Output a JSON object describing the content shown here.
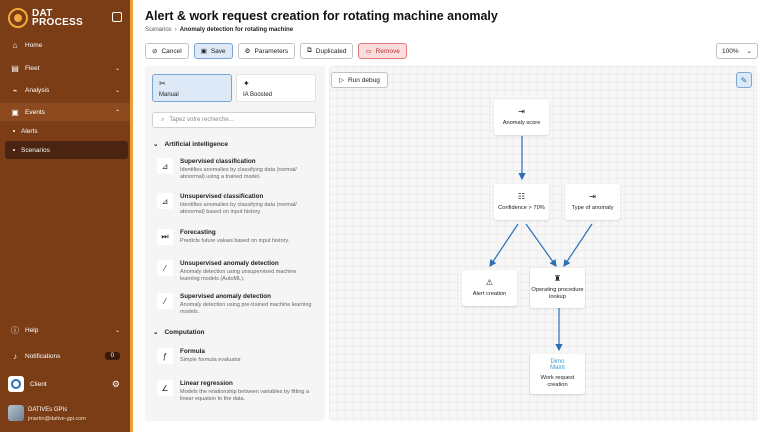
{
  "sidebar": {
    "logo_line1": "DAT",
    "logo_line2": "PROCESS",
    "nav": [
      {
        "label": "Home",
        "icon": "home-icon"
      },
      {
        "label": "Fleet",
        "icon": "fleet-icon"
      },
      {
        "label": "Analysis",
        "icon": "analysis-icon"
      },
      {
        "label": "Events",
        "icon": "events-icon"
      }
    ],
    "sub": [
      {
        "label": "Alerts"
      },
      {
        "label": "Scenarios"
      }
    ],
    "help": "Help",
    "notifications": "Notifications",
    "notifications_count": "0",
    "client": "Client",
    "user_org": "DATIVEs GPIs",
    "user_email": "jmartin@dative-gpi.com"
  },
  "header": {
    "title": "Alert & work request creation for rotating machine anomaly",
    "breadcrumb_root": "Scenarios",
    "breadcrumb_current": "Anomaly detection for rotating machine"
  },
  "toolbar": {
    "cancel": "Cancel",
    "save": "Save",
    "parameters": "Parameters",
    "duplicated": "Duplicated",
    "remove": "Remove",
    "zoom": "100%"
  },
  "panel": {
    "mode_manual": "Manual",
    "mode_ai": "IA Boosted",
    "search_placeholder": "Tapez votre recherche...",
    "section_ai": "Artificial intelligence",
    "section_comp": "Computation",
    "items": [
      {
        "title": "Supervised classification",
        "desc": "Identifies anomalies by classifying data (normal/ abnormal) using a trained model."
      },
      {
        "title": "Unsupervised classification",
        "desc": "Identifies anomalies by classifying data (normal/ abnormal) based on input history."
      },
      {
        "title": "Forecasting",
        "desc": "Predicts future values based on input history."
      },
      {
        "title": "Unsupervised anomaly detection",
        "desc": "Anomaly detection using unsupervised machine learning models (AutoML)."
      },
      {
        "title": "Supervised anomaly detection",
        "desc": "Anomaly detection using pre-trained machine learning models."
      },
      {
        "title": "Formula",
        "desc": "Simple formula evaluator"
      },
      {
        "title": "Linear regression",
        "desc": "Models the relationship between variables by fitting a linear equation to the data."
      }
    ]
  },
  "canvas": {
    "run_debug": "Run debug",
    "nodes": {
      "anomaly_score": "Anomaly score",
      "confidence": "Confidence > 70%",
      "type_anomaly": "Type of anomaly",
      "alert_creation": "Alert creation",
      "op_lookup": "Operating procedure lookup",
      "dimo_line1": "Dimo",
      "dimo_line2": "Maint",
      "work_request": "Work request creation"
    },
    "accent": "#2d6fb5"
  }
}
